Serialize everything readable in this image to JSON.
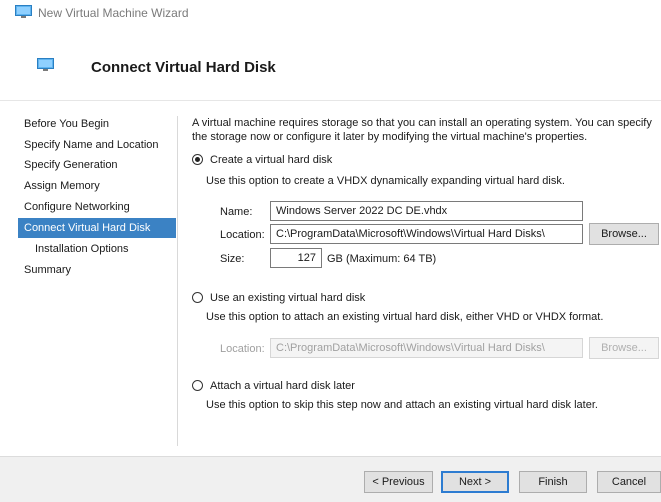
{
  "window": {
    "title": "New Virtual Machine Wizard",
    "icon": "monitor-icon"
  },
  "header": {
    "title": "Connect Virtual Hard Disk",
    "icon": "monitor-icon"
  },
  "sidebar": {
    "items": [
      {
        "label": "Before You Begin"
      },
      {
        "label": "Specify Name and Location"
      },
      {
        "label": "Specify Generation"
      },
      {
        "label": "Assign Memory"
      },
      {
        "label": "Configure Networking"
      },
      {
        "label": "Connect Virtual Hard Disk",
        "active": true
      },
      {
        "label": "Installation Options"
      },
      {
        "label": "Summary"
      }
    ]
  },
  "content": {
    "description": "A virtual machine requires storage so that you can install an operating system. You can specify the storage now or configure it later by modifying the virtual machine's properties.",
    "create_option": {
      "label": "Create a virtual hard disk",
      "selected": true,
      "help": "Use this option to create a VHDX dynamically expanding virtual hard disk.",
      "name_label": "Name:",
      "name_value": "Windows Server 2022 DC DE.vhdx",
      "location_label": "Location:",
      "location_value": "C:\\ProgramData\\Microsoft\\Windows\\Virtual Hard Disks\\",
      "browse_label": "Browse...",
      "size_label": "Size:",
      "size_value": "127",
      "size_unit": "GB (Maximum: 64 TB)"
    },
    "existing_option": {
      "label": "Use an existing virtual hard disk",
      "selected": false,
      "help": "Use this option to attach an existing virtual hard disk, either VHD or VHDX format.",
      "location_label": "Location:",
      "location_value": "C:\\ProgramData\\Microsoft\\Windows\\Virtual Hard Disks\\",
      "browse_label": "Browse..."
    },
    "later_option": {
      "label": "Attach a virtual hard disk later",
      "selected": false,
      "help": "Use this option to skip this step now and attach an existing virtual hard disk later."
    }
  },
  "footer": {
    "previous_label": "< Previous",
    "next_label": "Next >",
    "finish_label": "Finish",
    "cancel_label": "Cancel"
  },
  "colors": {
    "accent": "#3b82c4",
    "default_button_border": "#2d7cd1"
  }
}
